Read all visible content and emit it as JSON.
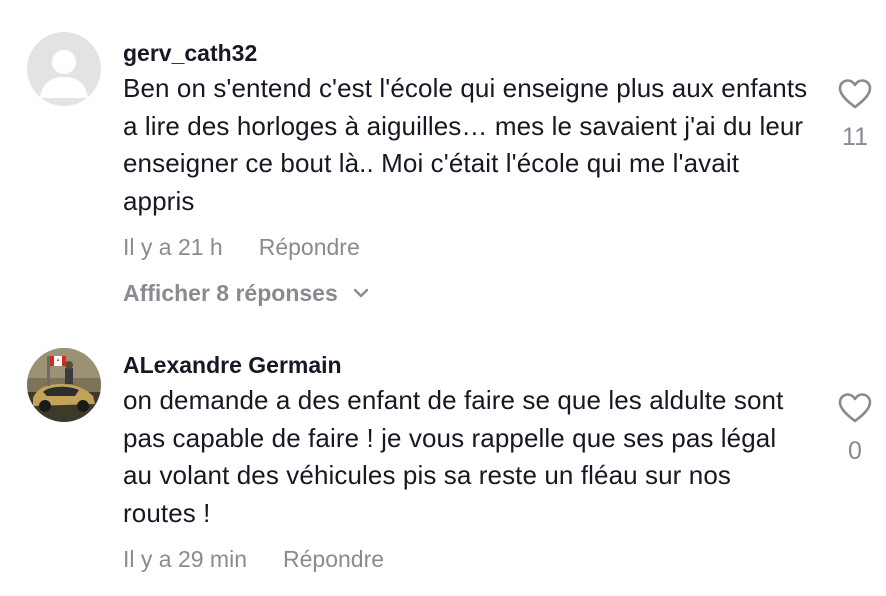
{
  "comments": [
    {
      "username": "gerv_cath32",
      "text": "Ben on s'entend c'est l'école qui enseigne plus aux enfants a lire des horloges à aiguilles… mes le savaient j'ai du leur enseigner ce bout là.. Moi c'était l'école qui me l'avait appris",
      "time": "Il y a 21 h",
      "reply_label": "Répondre",
      "view_replies_label": "Afficher 8 réponses",
      "like_count": "11",
      "avatar_icon": "default-user-avatar"
    },
    {
      "username": "ALexandre Germain",
      "text": "on demande a des enfant de faire se que les aldulte sont pas capable de faire ! je vous rappelle que ses pas légal au volant des véhicules pis sa reste un fléau sur nos routes !",
      "time": "Il y a 29 min",
      "reply_label": "Répondre",
      "like_count": "0",
      "avatar_icon": "profile-photo-car-canada-flag"
    }
  ],
  "colors": {
    "text_primary": "#161823",
    "text_secondary": "#8a8b91",
    "avatar_placeholder_bg": "#e3e3e4",
    "avatar_placeholder_fg": "#ffffff"
  }
}
